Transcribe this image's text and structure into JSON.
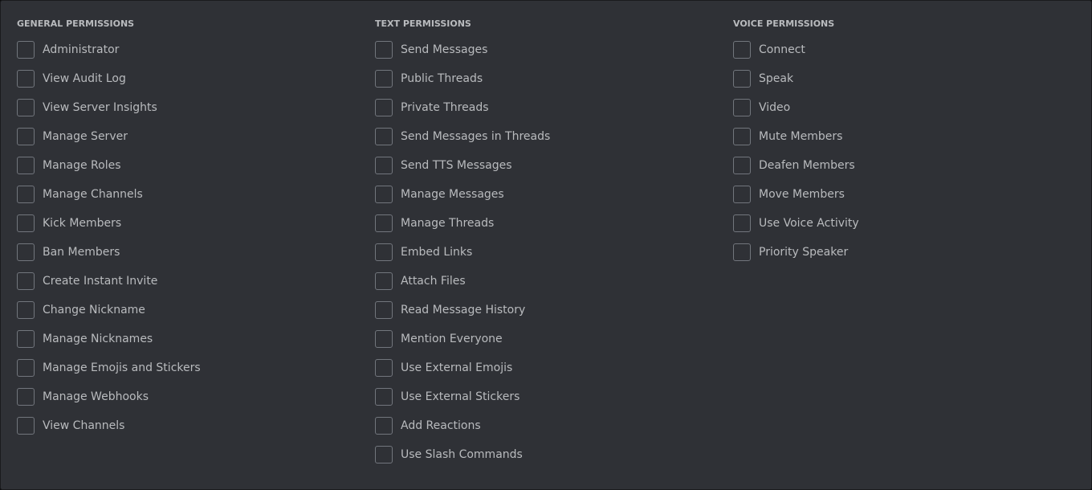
{
  "general": {
    "title": "GENERAL PERMISSIONS",
    "items": [
      {
        "label": "Administrator",
        "checked": false
      },
      {
        "label": "View Audit Log",
        "checked": false
      },
      {
        "label": "View Server Insights",
        "checked": false
      },
      {
        "label": "Manage Server",
        "checked": false
      },
      {
        "label": "Manage Roles",
        "checked": false
      },
      {
        "label": "Manage Channels",
        "checked": false
      },
      {
        "label": "Kick Members",
        "checked": false
      },
      {
        "label": "Ban Members",
        "checked": false
      },
      {
        "label": "Create Instant Invite",
        "checked": false
      },
      {
        "label": "Change Nickname",
        "checked": false
      },
      {
        "label": "Manage Nicknames",
        "checked": false
      },
      {
        "label": "Manage Emojis and Stickers",
        "checked": false
      },
      {
        "label": "Manage Webhooks",
        "checked": false
      },
      {
        "label": "View Channels",
        "checked": false
      }
    ]
  },
  "text": {
    "title": "TEXT PERMISSIONS",
    "items": [
      {
        "label": "Send Messages",
        "checked": false
      },
      {
        "label": "Public Threads",
        "checked": false
      },
      {
        "label": "Private Threads",
        "checked": false
      },
      {
        "label": "Send Messages in Threads",
        "checked": false
      },
      {
        "label": "Send TTS Messages",
        "checked": false
      },
      {
        "label": "Manage Messages",
        "checked": false
      },
      {
        "label": "Manage Threads",
        "checked": false
      },
      {
        "label": "Embed Links",
        "checked": false
      },
      {
        "label": "Attach Files",
        "checked": false
      },
      {
        "label": "Read Message History",
        "checked": false
      },
      {
        "label": "Mention Everyone",
        "checked": false
      },
      {
        "label": "Use External Emojis",
        "checked": false
      },
      {
        "label": "Use External Stickers",
        "checked": false
      },
      {
        "label": "Add Reactions",
        "checked": false
      },
      {
        "label": "Use Slash Commands",
        "checked": false
      }
    ]
  },
  "voice": {
    "title": "VOICE PERMISSIONS",
    "items": [
      {
        "label": "Connect",
        "checked": false
      },
      {
        "label": "Speak",
        "checked": false
      },
      {
        "label": "Video",
        "checked": false
      },
      {
        "label": "Mute Members",
        "checked": false
      },
      {
        "label": "Deafen Members",
        "checked": false
      },
      {
        "label": "Move Members",
        "checked": false
      },
      {
        "label": "Use Voice Activity",
        "checked": false
      },
      {
        "label": "Priority Speaker",
        "checked": false
      }
    ]
  },
  "colors": {
    "background": "#2f3136",
    "checkbox_border": "#72767d",
    "label": "#b9bbbe"
  }
}
